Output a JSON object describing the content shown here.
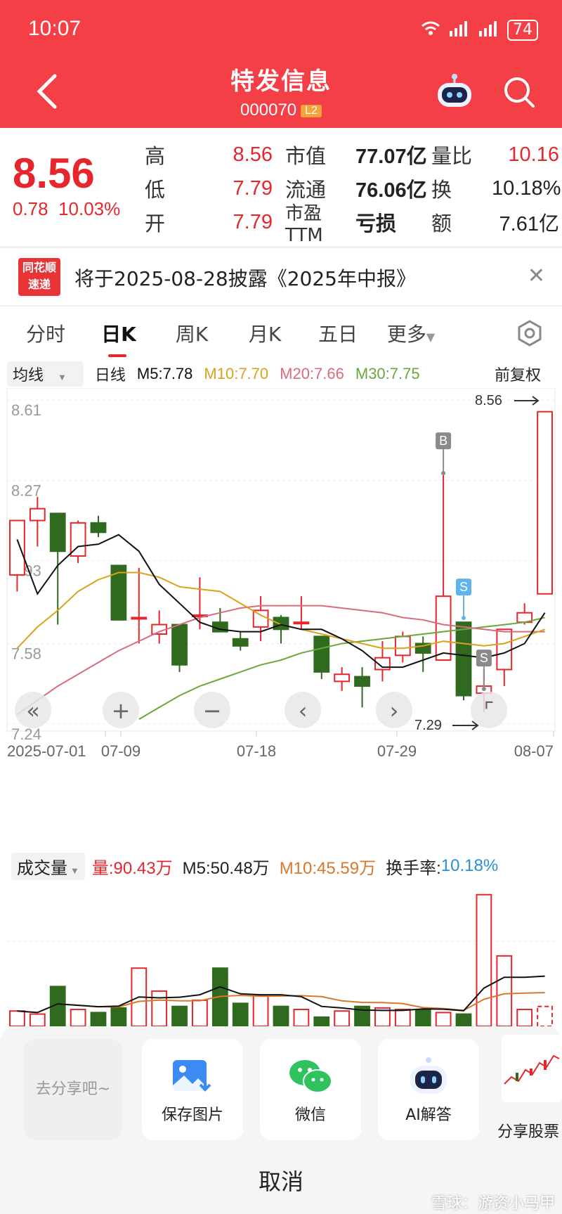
{
  "status": {
    "time": "10:07",
    "battery": "74"
  },
  "header": {
    "title": "特发信息",
    "code": "000070",
    "badge": "L2"
  },
  "quote": {
    "price": "8.56",
    "change": "0.78",
    "change_pct": "10.03%",
    "rows": [
      {
        "l1": "高",
        "v1": "8.56",
        "l2": "市值",
        "v2": "77.07亿",
        "l3": "量比",
        "v3": "10.16"
      },
      {
        "l1": "低",
        "v1": "7.79",
        "l2": "流通",
        "v2": "76.06亿",
        "l3": "换",
        "v3": "10.18%"
      },
      {
        "l1": "开",
        "v1": "7.79",
        "l2": "市盈TTM",
        "v2": "亏损",
        "l3": "额",
        "v3": "7.61亿"
      }
    ]
  },
  "notice": {
    "logo_top": "同花顺",
    "logo_bottom": "速递",
    "text": "将于2025-08-28披露《2025年中报》"
  },
  "tabs": [
    "分时",
    "日K",
    "周K",
    "月K",
    "五日",
    "更多"
  ],
  "ma": {
    "selector": "均线",
    "period": "日线",
    "m5": "M5:7.78",
    "m10": "M10:7.70",
    "m20": "M20:7.66",
    "m30": "M30:7.75",
    "adjust": "前复权"
  },
  "colors": {
    "up": "#e5262d",
    "down": "#2f6a1f",
    "m5": "#111111",
    "m10": "#d9a21b",
    "m20": "#d86b7c",
    "m30": "#6aa83c"
  },
  "chart_data": {
    "type": "candlestick",
    "y_ticks": [
      "8.61",
      "8.27",
      "7.93",
      "7.58",
      "7.24"
    ],
    "x_ticks": [
      "2025-07-01",
      "07-09",
      "07-18",
      "07-29",
      "08-07"
    ],
    "high_label": "8.56",
    "low_label": "7.29",
    "markers": [
      "B",
      "S",
      "S"
    ],
    "candles": [
      {
        "o": 7.87,
        "c": 8.1,
        "h": 8.1,
        "l": 7.8
      },
      {
        "o": 8.1,
        "c": 8.15,
        "h": 8.2,
        "l": 7.99
      },
      {
        "o": 8.13,
        "c": 7.97,
        "h": 8.13,
        "l": 7.66
      },
      {
        "o": 7.95,
        "c": 8.09,
        "h": 8.1,
        "l": 7.92
      },
      {
        "o": 8.09,
        "c": 8.05,
        "h": 8.12,
        "l": 8.03
      },
      {
        "o": 7.91,
        "c": 7.68,
        "h": 7.91,
        "l": 7.68
      },
      {
        "o": 7.69,
        "c": 7.69,
        "h": 7.9,
        "l": 7.58
      },
      {
        "o": 7.62,
        "c": 7.66,
        "h": 7.72,
        "l": 7.58
      },
      {
        "o": 7.66,
        "c": 7.49,
        "h": 7.66,
        "l": 7.46
      },
      {
        "o": 7.7,
        "c": 7.7,
        "h": 7.86,
        "l": 7.64
      },
      {
        "o": 7.67,
        "c": 7.63,
        "h": 7.73,
        "l": 7.63
      },
      {
        "o": 7.6,
        "c": 7.57,
        "h": 7.63,
        "l": 7.55
      },
      {
        "o": 7.65,
        "c": 7.72,
        "h": 7.78,
        "l": 7.59
      },
      {
        "o": 7.69,
        "c": 7.64,
        "h": 7.7,
        "l": 7.58
      },
      {
        "o": 7.67,
        "c": 7.67,
        "h": 7.78,
        "l": 7.64
      },
      {
        "o": 7.61,
        "c": 7.46,
        "h": 7.61,
        "l": 7.43
      },
      {
        "o": 7.42,
        "c": 7.45,
        "h": 7.48,
        "l": 7.38
      },
      {
        "o": 7.44,
        "c": 7.4,
        "h": 7.48,
        "l": 7.31
      },
      {
        "o": 7.47,
        "c": 7.52,
        "h": 7.59,
        "l": 7.42
      },
      {
        "o": 7.53,
        "c": 7.61,
        "h": 7.63,
        "l": 7.5
      },
      {
        "o": 7.58,
        "c": 7.54,
        "h": 7.61,
        "l": 7.46
      },
      {
        "o": 7.51,
        "c": 7.78,
        "h": 8.3,
        "l": 7.51
      },
      {
        "o": 7.67,
        "c": 7.36,
        "h": 7.67,
        "l": 7.34
      },
      {
        "o": 7.37,
        "c": 7.4,
        "h": 7.47,
        "l": 7.29
      },
      {
        "o": 7.47,
        "c": 7.64,
        "h": 7.64,
        "l": 7.4
      },
      {
        "o": 7.67,
        "c": 7.71,
        "h": 7.75,
        "l": 7.66
      },
      {
        "o": 7.79,
        "c": 8.56,
        "h": 8.56,
        "l": 7.79
      }
    ],
    "m5": [
      8.02,
      7.79,
      7.91,
      7.99,
      8.0,
      8.04,
      7.97,
      7.83,
      7.75,
      7.67,
      7.64,
      7.63,
      7.63,
      7.66,
      7.64,
      7.64,
      7.6,
      7.55,
      7.48,
      7.48,
      7.51,
      7.54,
      7.53,
      7.52,
      7.54,
      7.58,
      7.71
    ],
    "m10": [
      7.56,
      7.65,
      7.72,
      7.8,
      7.85,
      7.88,
      7.88,
      7.86,
      7.82,
      7.81,
      7.8,
      7.75,
      7.7,
      7.66,
      7.64,
      7.62,
      7.6,
      7.58,
      7.56,
      7.56,
      7.57,
      7.59,
      7.58,
      7.57,
      7.58,
      7.61,
      7.64
    ],
    "m20": [
      7.28,
      7.34,
      7.4,
      7.45,
      7.5,
      7.55,
      7.59,
      7.63,
      7.66,
      7.69,
      7.71,
      7.73,
      7.74,
      7.74,
      7.74,
      7.74,
      7.73,
      7.72,
      7.71,
      7.69,
      7.68,
      7.66,
      7.65,
      7.64,
      7.63,
      7.63,
      7.63
    ],
    "m30": [
      null,
      null,
      null,
      null,
      null,
      null,
      7.26,
      7.31,
      7.36,
      7.4,
      7.43,
      7.46,
      7.49,
      7.51,
      7.54,
      7.56,
      7.58,
      7.59,
      7.6,
      7.61,
      7.62,
      7.63,
      7.64,
      7.65,
      7.66,
      7.67,
      7.69
    ],
    "volume": {
      "legend_selector": "成交量",
      "vol": "量:90.43万",
      "m5": "M5:50.48万",
      "m10": "M10:45.59万",
      "turnover_label": "换手率:",
      "turnover": "10.18%",
      "bars": [
        10,
        8,
        26,
        11,
        9,
        12,
        38,
        23,
        13,
        17,
        38,
        15,
        20,
        13,
        11,
        6,
        10,
        13,
        12,
        11,
        11,
        9,
        8,
        86,
        46,
        11,
        13
      ]
    }
  },
  "share": {
    "hint": "去分享吧~",
    "items": [
      "保存图片",
      "微信",
      "AI解答"
    ],
    "stock_share": "分享股票",
    "cancel": "取消",
    "watermark": "雪球：游资小马甲"
  }
}
